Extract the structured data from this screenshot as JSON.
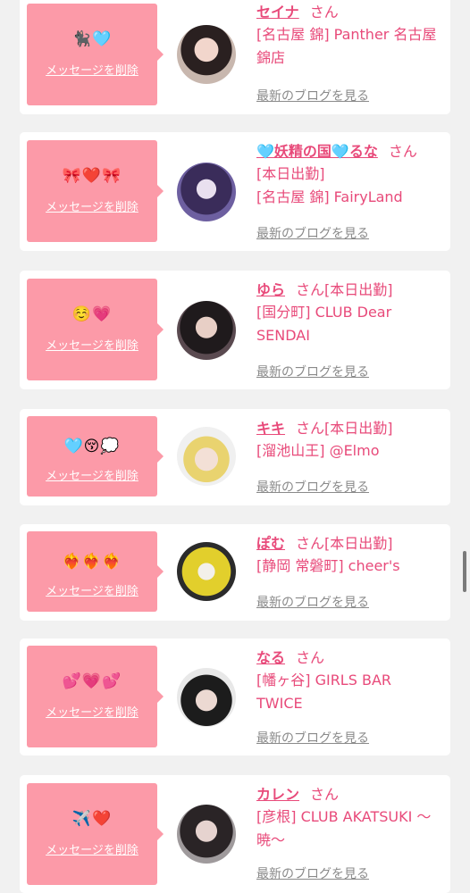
{
  "delete_label": "メッセージを削除",
  "blog_label": "最新のブログを見る",
  "san_label": "さん",
  "accent_color": "#e84a7a",
  "message_bg_color": "#fc9aa8",
  "cards": [
    {
      "emojis": "🐈‍⬛🩵",
      "name": "セイナ",
      "status": "",
      "shop": "[名古屋 錦] Panther 名古屋錦店"
    },
    {
      "emojis": "🎀❤️🎀",
      "name": "🩵妖精の国🩵るな",
      "status": "",
      "shop": "[本日出勤]\n[名古屋 錦] FairyLand"
    },
    {
      "emojis": "☺️💗",
      "name": "ゆら",
      "status": "[本日出勤]",
      "shop": "[国分町] CLUB Dear SENDAI"
    },
    {
      "emojis": "🩵😚💭",
      "name": "キキ",
      "status": "[本日出勤]",
      "shop": "[溜池山王] @Elmo"
    },
    {
      "emojis": "❤️‍🔥❤️‍🔥❤️‍🔥",
      "name": "ぽむ",
      "status": "[本日出勤]",
      "shop": "[静岡 常磐町] cheer's"
    },
    {
      "emojis": "💕💗💕",
      "name": "なる",
      "status": "",
      "shop": "[幡ヶ谷] GIRLS BAR TWICE"
    },
    {
      "emojis": "✈️❤️",
      "name": "カレン",
      "status": "",
      "shop": "[彦根] CLUB AKATSUKI 〜暁〜"
    }
  ]
}
